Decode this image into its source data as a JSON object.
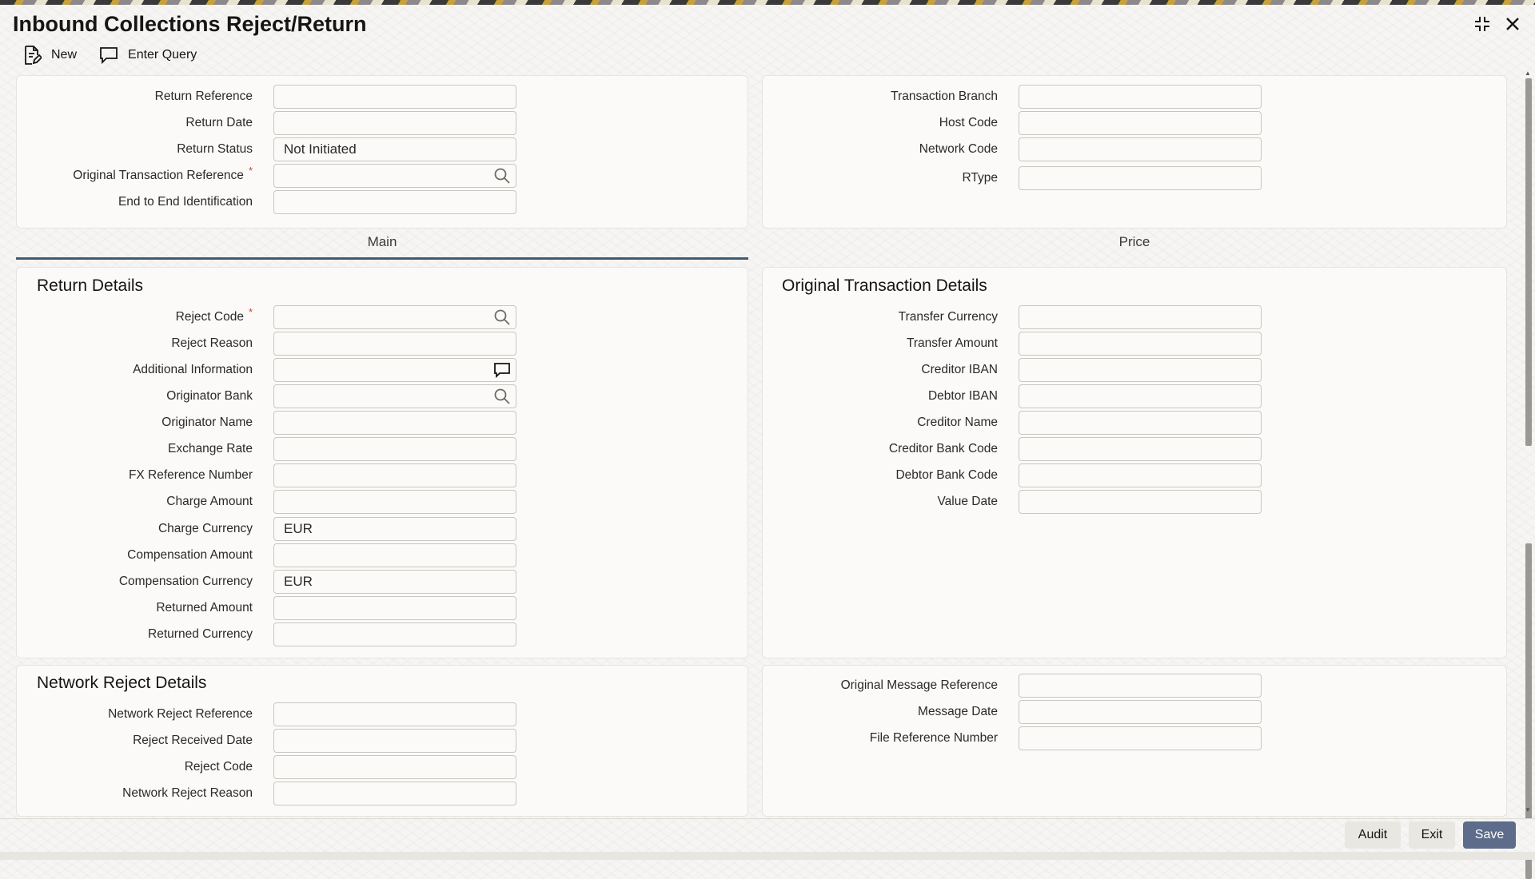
{
  "window": {
    "title": "Inbound Collections Reject/Return"
  },
  "toolbar": {
    "new_label": "New",
    "enter_query_label": "Enter Query"
  },
  "header_left": {
    "return_reference": {
      "label": "Return Reference",
      "value": ""
    },
    "return_date": {
      "label": "Return Date",
      "value": ""
    },
    "return_status": {
      "label": "Return Status",
      "value": "Not Initiated"
    },
    "original_transaction_reference": {
      "label": "Original Transaction Reference",
      "value": "",
      "required": "*"
    },
    "end_to_end_identification": {
      "label": "End to End Identification",
      "value": ""
    }
  },
  "header_right": {
    "transaction_branch": {
      "label": "Transaction Branch",
      "value": ""
    },
    "host_code": {
      "label": "Host Code",
      "value": ""
    },
    "network_code": {
      "label": "Network Code",
      "value": ""
    },
    "rtype": {
      "label": "RType",
      "value": ""
    }
  },
  "tabs": {
    "main": "Main",
    "price": "Price"
  },
  "return_details": {
    "title": "Return Details",
    "reject_code": {
      "label": "Reject Code",
      "value": "",
      "required": "*"
    },
    "reject_reason": {
      "label": "Reject Reason",
      "value": ""
    },
    "additional_information": {
      "label": "Additional Information",
      "value": ""
    },
    "originator_bank": {
      "label": "Originator Bank",
      "value": ""
    },
    "originator_name": {
      "label": "Originator Name",
      "value": ""
    },
    "exchange_rate": {
      "label": "Exchange Rate",
      "value": ""
    },
    "fx_reference_number": {
      "label": "FX Reference Number",
      "value": ""
    },
    "charge_amount": {
      "label": "Charge Amount",
      "value": ""
    },
    "charge_currency": {
      "label": "Charge Currency",
      "value": "EUR"
    },
    "compensation_amount": {
      "label": "Compensation Amount",
      "value": ""
    },
    "compensation_currency": {
      "label": "Compensation Currency",
      "value": "EUR"
    },
    "returned_amount": {
      "label": "Returned Amount",
      "value": ""
    },
    "returned_currency": {
      "label": "Returned Currency",
      "value": ""
    }
  },
  "original_transaction_details": {
    "title": "Original Transaction Details",
    "transfer_currency": {
      "label": "Transfer Currency",
      "value": ""
    },
    "transfer_amount": {
      "label": "Transfer Amount",
      "value": ""
    },
    "creditor_iban": {
      "label": "Creditor IBAN",
      "value": ""
    },
    "debtor_iban": {
      "label": "Debtor IBAN",
      "value": ""
    },
    "creditor_name": {
      "label": "Creditor Name",
      "value": ""
    },
    "creditor_bank_code": {
      "label": "Creditor Bank Code",
      "value": ""
    },
    "debtor_bank_code": {
      "label": "Debtor Bank Code",
      "value": ""
    },
    "value_date": {
      "label": "Value Date",
      "value": ""
    }
  },
  "network_reject_details": {
    "title": "Network Reject Details",
    "network_reject_reference": {
      "label": "Network Reject Reference",
      "value": ""
    },
    "reject_received_date": {
      "label": "Reject Received Date",
      "value": ""
    },
    "reject_code": {
      "label": "Reject Code",
      "value": ""
    },
    "network_reject_reason": {
      "label": "Network Reject Reason",
      "value": ""
    }
  },
  "message_details": {
    "original_message_reference": {
      "label": "Original Message Reference",
      "value": ""
    },
    "message_date": {
      "label": "Message Date",
      "value": ""
    },
    "file_reference_number": {
      "label": "File Reference Number",
      "value": ""
    }
  },
  "footer": {
    "audit_label": "Audit",
    "exit_label": "Exit",
    "save_label": "Save"
  },
  "colors": {
    "primary_button": "#5c6c8a",
    "required": "#c74634",
    "tab_underline": "#3f5b73"
  }
}
